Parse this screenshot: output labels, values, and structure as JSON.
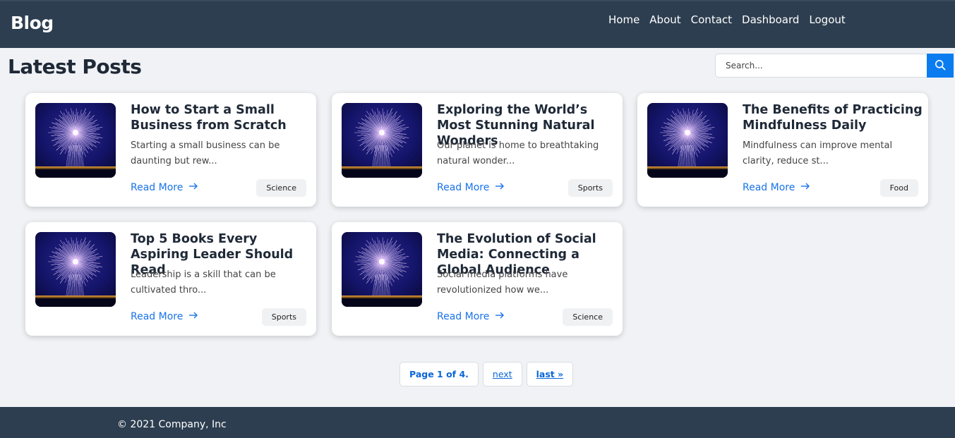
{
  "header": {
    "brand": "Blog",
    "nav": [
      "Home",
      "About",
      "Contact",
      "Dashboard",
      "Logout"
    ]
  },
  "main": {
    "title": "Latest Posts",
    "search": {
      "placeholder": "Search...",
      "value": ""
    },
    "read_more_label": "Read More",
    "posts": [
      {
        "title": "How to Start a Small Business from Scratch",
        "excerpt": "Starting a small business can be daunting but rew...",
        "category": "Science"
      },
      {
        "title": "Exploring the World’s Most Stunning Natural Wonders",
        "excerpt": "Our planet is home to breathtaking natural wonder...",
        "category": "Sports"
      },
      {
        "title": "The Benefits of Practicing Mindfulness Daily",
        "excerpt": "Mindfulness can improve mental clarity, reduce st...",
        "category": "Food"
      },
      {
        "title": "Top 5 Books Every Aspiring Leader Should Read",
        "excerpt": "Leadership is a skill that can be cultivated thro...",
        "category": "Sports"
      },
      {
        "title": "The Evolution of Social Media: Connecting a Global Audience",
        "excerpt": "Social media platforms have revolutionized how we...",
        "category": "Science"
      }
    ]
  },
  "pagination": {
    "status": "Page 1 of 4.",
    "next": "next",
    "last": "last »"
  },
  "footer": {
    "copyright": "© 2021 Company, Inc"
  },
  "icons": {
    "search": "search-icon",
    "read_more_arrow": "arrow-right-icon"
  },
  "colors": {
    "nav_bg": "#2d3e50",
    "accent": "#0a7cf0",
    "link": "#1a73e8",
    "page_bg": "#f0f2f5"
  }
}
